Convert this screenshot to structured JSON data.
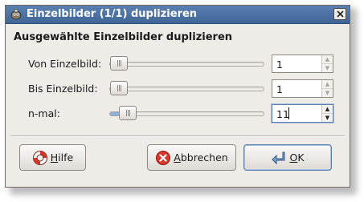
{
  "window": {
    "title": "Einzelbilder (1/1) duplizieren",
    "app_icon": "gimp-wilber-icon",
    "close_icon": "close-x-icon"
  },
  "dialog": {
    "heading": "Ausgewählte Einzelbilder duplizieren",
    "rows": [
      {
        "label": "Von Einzelbild:",
        "value": "1",
        "slider_fraction": 0.0
      },
      {
        "label": "Bis Einzelbild:",
        "value": "1",
        "slider_fraction": 0.0
      },
      {
        "label": "n-mal:",
        "value": "11",
        "slider_fraction": 0.1
      }
    ]
  },
  "buttons": {
    "help": {
      "mnemonic": "H",
      "rest": "ilfe",
      "icon": "lifebuoy-icon"
    },
    "cancel": {
      "mnemonic": "A",
      "rest": "bbrechen",
      "icon": "cancel-x-icon"
    },
    "ok": {
      "mnemonic": "O",
      "rest": "K",
      "icon": "enter-arrow-icon"
    }
  },
  "colors": {
    "titlebar": "#3f6597",
    "accent": "#8cb0dc",
    "cancel_red": "#d9372b"
  }
}
